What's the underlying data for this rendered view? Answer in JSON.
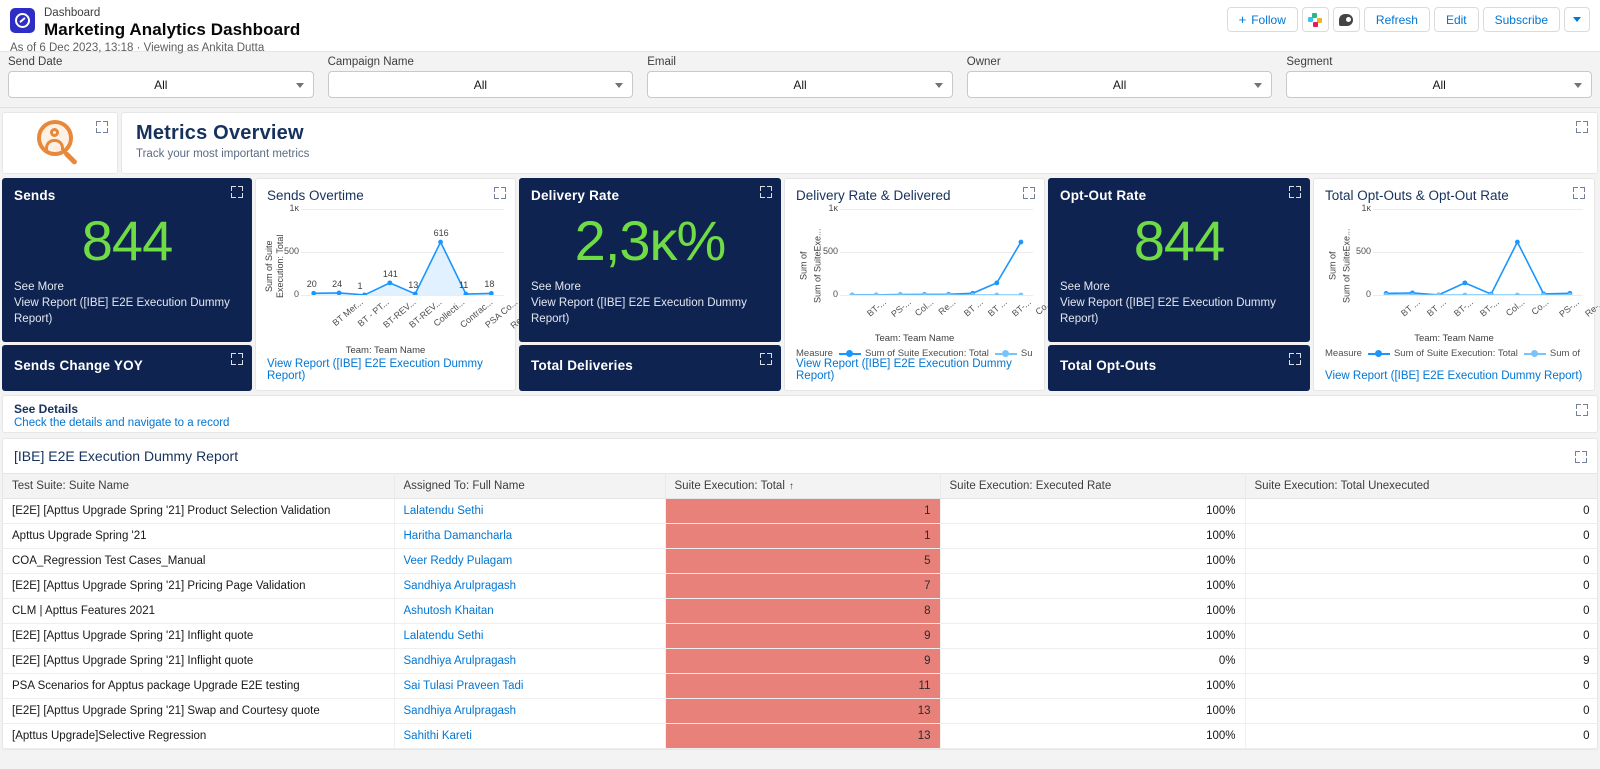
{
  "header": {
    "kicker": "Dashboard",
    "title": "Marketing Analytics Dashboard",
    "subtitle": "As of 6 Dec 2023, 13:18 · Viewing as Ankita Dutta",
    "app_icon": "compass-icon",
    "actions": {
      "follow": "Follow",
      "slack": "slack-icon",
      "chat": "chatter-icon",
      "refresh": "Refresh",
      "edit": "Edit",
      "subscribe": "Subscribe",
      "more": "chevron-down-icon"
    }
  },
  "filters": [
    {
      "label": "Send Date",
      "value": "All"
    },
    {
      "label": "Campaign Name",
      "value": "All"
    },
    {
      "label": "Email",
      "value": "All"
    },
    {
      "label": "Owner",
      "value": "All"
    },
    {
      "label": "Segment",
      "value": "All"
    }
  ],
  "banner": {
    "image_icon": "magnifying-glass-person-icon",
    "title": "Metrics Overview",
    "subtitle": "Track your most important metrics"
  },
  "kpi_sends": {
    "title": "Sends",
    "value": "844",
    "see_more": "See More",
    "view_report": "View Report ([IBE] E2E Execution Dummy Report)"
  },
  "kpi_sends_yoy": {
    "title": "Sends Change YOY"
  },
  "kpi_delivery_rate": {
    "title": "Delivery Rate",
    "value": "2,3ĸ%",
    "see_more": "See More",
    "view_report": "View Report ([IBE] E2E Execution Dummy Report)"
  },
  "kpi_total_deliveries": {
    "title": "Total Deliveries"
  },
  "kpi_optout_rate": {
    "title": "Opt-Out Rate",
    "value": "844",
    "see_more": "See More",
    "view_report": "View Report ([IBE] E2E Execution Dummy Report)"
  },
  "kpi_total_optouts": {
    "title": "Total Opt-Outs"
  },
  "chart_data": [
    {
      "id": "sends_overtime",
      "type": "line",
      "title": "Sends Overtime",
      "ylabel": "Sum of Suite Execution: Total",
      "xlabel": "Team: Team Name",
      "categories": [
        "BT Mer...",
        "BT - PT...",
        "BT-REV...",
        "BT-REV...",
        "Collecti...",
        "Contrac...",
        "PSA Co...",
        "Renewa..."
      ],
      "values": [
        20,
        24,
        1,
        141,
        13,
        616,
        11,
        18
      ],
      "point_labels": [
        "20",
        "24",
        "1",
        "141",
        "13",
        "616",
        "11",
        "18"
      ],
      "yticks": [
        "1ĸ",
        "500",
        "0"
      ],
      "ylim": [
        0,
        1000
      ],
      "grid": true,
      "legend": null,
      "view_report": "View Report ([IBE] E2E Execution Dummy Report)"
    },
    {
      "id": "delivery_rate_delivered",
      "type": "line",
      "title": "Delivery Rate & Delivered",
      "ylabel": "Sum of SuiteExe...",
      "xlabel": "Team: Team Name",
      "categories": [
        "BT-...",
        "PS-...",
        "Col...",
        "Re...",
        "BT ...",
        "BT ...",
        "BT-...",
        "Co..."
      ],
      "yticks": [
        "1ĸ",
        "500",
        "0"
      ],
      "ylim": [
        0,
        1000
      ],
      "grid": true,
      "series": [
        {
          "name": "Sum of Suite Execution: Total",
          "values": [
            1,
            1,
            5,
            7,
            8,
            20,
            141,
            616
          ],
          "color": "#1b96ff"
        },
        {
          "name": "Sum of",
          "values": [
            0,
            0,
            0,
            0,
            0,
            0,
            0,
            0
          ],
          "color": "#78c3fb"
        }
      ],
      "legend_title": "Measure",
      "legend_position": "bottom",
      "view_report": "View Report ([IBE] E2E Execution Dummy Report)"
    },
    {
      "id": "total_optouts_rate",
      "type": "line",
      "title": "Total Opt-Outs & Opt-Out Rate",
      "ylabel": "Sum of SuiteExe...",
      "xlabel": "Team: Team Name",
      "categories": [
        "BT ...",
        "BT ...",
        "BT-...",
        "BT-...",
        "Col...",
        "Co...",
        "PS-...",
        "Re-..."
      ],
      "yticks": [
        "1ĸ",
        "500",
        "0"
      ],
      "ylim": [
        0,
        1000
      ],
      "grid": true,
      "series": [
        {
          "name": "Sum of Suite Execution: Total",
          "values": [
            18,
            24,
            1,
            141,
            11,
            616,
            13,
            20
          ],
          "color": "#1b96ff"
        },
        {
          "name": "Sum of",
          "values": [
            0,
            0,
            0,
            0,
            0,
            0,
            0,
            0
          ],
          "color": "#78c3fb"
        }
      ],
      "legend_title": "Measure",
      "legend_position": "bottom",
      "view_report": "View Report ([IBE] E2E Execution Dummy Report)"
    }
  ],
  "details": {
    "title": "See Details",
    "subtitle": "Check the details and navigate to a record"
  },
  "report": {
    "title": "[IBE] E2E Execution Dummy Report",
    "columns": [
      "Test Suite: Suite Name",
      "Assigned To: Full Name",
      "Suite Execution: Total",
      "Suite Execution: Executed Rate",
      "Suite Execution: Total Unexecuted"
    ],
    "sorted_column_index": 2,
    "sort_direction": "↑",
    "rows": [
      {
        "suite": "[E2E] [Apttus Upgrade Spring '21] Product Selection Validation",
        "assigned": "Lalatendu Sethi",
        "total": "1",
        "rate": "100%",
        "unexecuted": "0"
      },
      {
        "suite": "Apttus Upgrade Spring '21",
        "assigned": "Haritha Damancharla",
        "total": "1",
        "rate": "100%",
        "unexecuted": "0"
      },
      {
        "suite": "COA_Regression Test Cases_Manual",
        "assigned": "Veer Reddy Pulagam",
        "total": "5",
        "rate": "100%",
        "unexecuted": "0"
      },
      {
        "suite": "[E2E] [Apttus Upgrade Spring '21] Pricing Page Validation",
        "assigned": "Sandhiya Arulpragash",
        "total": "7",
        "rate": "100%",
        "unexecuted": "0"
      },
      {
        "suite": "CLM | Apttus Features 2021",
        "assigned": "Ashutosh Khaitan",
        "total": "8",
        "rate": "100%",
        "unexecuted": "0"
      },
      {
        "suite": "[E2E] [Apttus Upgrade Spring '21] Inflight quote",
        "assigned": "Lalatendu Sethi",
        "total": "9",
        "rate": "100%",
        "unexecuted": "0"
      },
      {
        "suite": "[E2E] [Apttus Upgrade Spring '21] Inflight quote",
        "assigned": "Sandhiya Arulpragash",
        "total": "9",
        "rate": "0%",
        "unexecuted": "9"
      },
      {
        "suite": "PSA Scenarios for Apptus package Upgrade E2E testing",
        "assigned": "Sai Tulasi Praveen Tadi",
        "total": "11",
        "rate": "100%",
        "unexecuted": "0"
      },
      {
        "suite": "[E2E] [Apttus Upgrade Spring '21] Swap and Courtesy quote",
        "assigned": "Sandhiya Arulpragash",
        "total": "13",
        "rate": "100%",
        "unexecuted": "0"
      },
      {
        "suite": "[Apttus Upgrade]Selective Regression",
        "assigned": "Sahithi Kareti",
        "total": "13",
        "rate": "100%",
        "unexecuted": "0"
      }
    ]
  },
  "colors": {
    "card_bg": "#0f2350",
    "kpi_value": "#6fdb45",
    "link": "#0176d3",
    "heat_cell": "#e8817a",
    "series_primary": "#1b96ff",
    "series_secondary": "#78c3fb"
  }
}
